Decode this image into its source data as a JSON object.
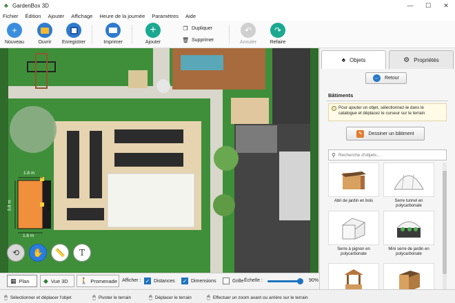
{
  "window": {
    "title": "GardenBox 3D"
  },
  "menu": [
    "Fichier",
    "Édition",
    "Ajouter",
    "Affichage",
    "Heure de la journée",
    "Paramètres",
    "Aide"
  ],
  "toolbar": {
    "nouveau": "Nouveau",
    "ouvrir": "Ouvrir",
    "enregistrer": "Enregistrer",
    "imprimer": "Imprimer",
    "ajouter": "Ajouter",
    "dupliquer": "Dupliquer",
    "supprimer": "Supprimer",
    "annuler": "Annuler",
    "refaire": "Refaire"
  },
  "canvas": {
    "dim_top": "1.8 m",
    "dim_left": "3.8 m",
    "dim_right": "3.8 m",
    "dim_bottom": "1.8 m",
    "text_tool": "T"
  },
  "view_tabs": {
    "plan": "Plan",
    "vue3d": "Vue 3D",
    "promenade": "Promenade"
  },
  "display": {
    "label": "Afficher :",
    "distances": "Distances",
    "dimensions": "Dimensions",
    "grille": "Grille",
    "echelle": "Échelle :",
    "zoom": "90%",
    "zoom_fraction": 0.9
  },
  "status": {
    "select": "Sélectionner et déplacer l'objet",
    "rotate": "Pivoter le terrain",
    "move": "Déplacer le terrain",
    "zoom": "Effectuer un zoom avant ou arrière sur le terrain"
  },
  "sidepanel": {
    "tab_objets": "Objets",
    "tab_proprietes": "Propriétés",
    "retour": "Retour",
    "section": "Bâtiments",
    "info": "Pour ajouter un objet, sélectionnez-le dans le catalogue et déplacez le curseur sur le terrain",
    "dessiner": "Dessiner un bâtiment",
    "search_placeholder": "Recherche d'objets...",
    "items": [
      {
        "label": "Abri de jardin en bois"
      },
      {
        "label": "Serre tunnel en polycarbonate"
      },
      {
        "label": "Serre à pignon en polycarbonate"
      },
      {
        "label": "Mini serre de jardin en polycarbonate"
      },
      {
        "label": ""
      },
      {
        "label": ""
      }
    ]
  },
  "colors": {
    "accent": "#2b7de0",
    "grass": "#3f8f3a",
    "soil": "#e6d3b0"
  }
}
